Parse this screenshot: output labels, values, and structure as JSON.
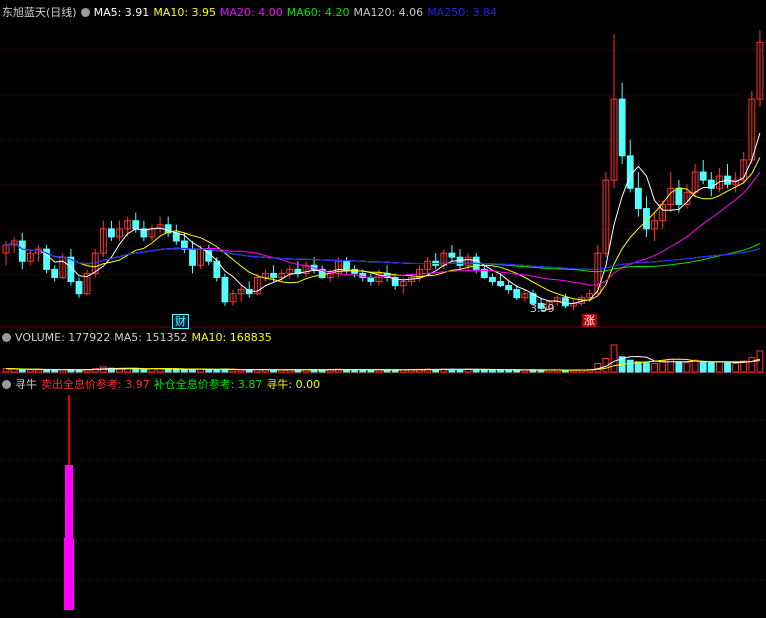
{
  "colors": {
    "bg": "#000000",
    "grid": "#7a0000",
    "up": "#ff3232",
    "down": "#54ffff",
    "ma5": "#ffffff",
    "ma10": "#ffff00",
    "ma20": "#ff00ff",
    "ma60": "#00e600",
    "ma120": "#c8c8c8",
    "ma250": "#2020ff",
    "label_gray": "#d0d0d0"
  },
  "panel_price": {
    "title": "东旭蓝天(日线)",
    "indicators": [
      {
        "label": "MA5: 3.91",
        "color": "#ffffff"
      },
      {
        "label": "MA10: 3.95",
        "color": "#ffff00"
      },
      {
        "label": "MA20: 4.00",
        "color": "#ff00ff"
      },
      {
        "label": "MA60: 4.20",
        "color": "#00e600"
      },
      {
        "label": "MA120: 4.06",
        "color": "#c8c8c8"
      },
      {
        "label": "MA250: 3.84",
        "color": "#2020ff"
      }
    ],
    "low_label": "3.59",
    "marker_cai": "财",
    "marker_zhang": "涨"
  },
  "panel_volume": {
    "indicators": [
      {
        "label": "VOLUME: 177922",
        "color": "#d0d0d0"
      },
      {
        "label": "MA5: 151352",
        "color": "#d0d0d0"
      },
      {
        "label": "MA10: 168835",
        "color": "#ffff00"
      }
    ]
  },
  "panel_indicator": {
    "title": "寻牛",
    "indicators": [
      {
        "label": "卖出全息价参考: 3.97",
        "color": "#ff3232"
      },
      {
        "label": "补仓全息价参考: 3.87",
        "color": "#00e600"
      },
      {
        "label": "寻牛: 0.00",
        "color": "#ffff00"
      }
    ]
  },
  "chart_data": {
    "type": "candlestick",
    "y_range": [
      3.5,
      7.2
    ],
    "candles": [
      [
        4.3,
        4.45,
        4.15,
        4.4
      ],
      [
        4.4,
        4.5,
        4.3,
        4.45
      ],
      [
        4.45,
        4.55,
        4.1,
        4.2
      ],
      [
        4.2,
        4.35,
        4.15,
        4.3
      ],
      [
        4.3,
        4.4,
        4.2,
        4.35
      ],
      [
        4.35,
        4.4,
        4.05,
        4.1
      ],
      [
        4.1,
        4.15,
        3.95,
        4.0
      ],
      [
        4.0,
        4.3,
        3.98,
        4.25
      ],
      [
        4.25,
        4.35,
        3.9,
        3.95
      ],
      [
        3.95,
        4.0,
        3.75,
        3.8
      ],
      [
        3.8,
        4.1,
        3.78,
        4.05
      ],
      [
        4.05,
        4.35,
        4.0,
        4.3
      ],
      [
        4.3,
        4.7,
        4.25,
        4.6
      ],
      [
        4.6,
        4.7,
        4.45,
        4.5
      ],
      [
        4.5,
        4.7,
        4.45,
        4.6
      ],
      [
        4.6,
        4.75,
        4.5,
        4.7
      ],
      [
        4.7,
        4.8,
        4.55,
        4.6
      ],
      [
        4.6,
        4.7,
        4.45,
        4.5
      ],
      [
        4.5,
        4.65,
        4.45,
        4.6
      ],
      [
        4.6,
        4.75,
        4.55,
        4.65
      ],
      [
        4.65,
        4.75,
        4.5,
        4.55
      ],
      [
        4.55,
        4.65,
        4.4,
        4.45
      ],
      [
        4.45,
        4.55,
        4.3,
        4.35
      ],
      [
        4.35,
        4.45,
        4.05,
        4.15
      ],
      [
        4.15,
        4.4,
        4.1,
        4.35
      ],
      [
        4.35,
        4.4,
        4.15,
        4.2
      ],
      [
        4.2,
        4.25,
        3.95,
        4.0
      ],
      [
        4.0,
        4.05,
        3.65,
        3.7
      ],
      [
        3.7,
        3.85,
        3.65,
        3.8
      ],
      [
        3.8,
        3.9,
        3.7,
        3.85
      ],
      [
        3.85,
        3.95,
        3.75,
        3.8
      ],
      [
        3.8,
        4.05,
        3.78,
        4.0
      ],
      [
        4.0,
        4.1,
        3.95,
        4.05
      ],
      [
        4.05,
        4.15,
        3.95,
        4.0
      ],
      [
        4.0,
        4.1,
        3.95,
        4.05
      ],
      [
        4.05,
        4.15,
        3.98,
        4.1
      ],
      [
        4.1,
        4.2,
        4.0,
        4.05
      ],
      [
        4.05,
        4.2,
        4.0,
        4.15
      ],
      [
        4.15,
        4.25,
        4.05,
        4.1
      ],
      [
        4.1,
        4.15,
        3.98,
        4.0
      ],
      [
        4.0,
        4.1,
        3.95,
        4.05
      ],
      [
        4.05,
        4.25,
        4.0,
        4.2
      ],
      [
        4.2,
        4.25,
        4.05,
        4.1
      ],
      [
        4.1,
        4.15,
        4.0,
        4.05
      ],
      [
        4.05,
        4.1,
        3.95,
        4.0
      ],
      [
        4.0,
        4.05,
        3.9,
        3.95
      ],
      [
        3.95,
        4.1,
        3.9,
        4.05
      ],
      [
        4.05,
        4.15,
        3.95,
        4.0
      ],
      [
        4.0,
        4.05,
        3.85,
        3.9
      ],
      [
        3.9,
        4.0,
        3.8,
        3.95
      ],
      [
        3.95,
        4.05,
        3.9,
        4.0
      ],
      [
        4.0,
        4.15,
        3.95,
        4.1
      ],
      [
        4.1,
        4.25,
        4.05,
        4.2
      ],
      [
        4.2,
        4.3,
        4.1,
        4.15
      ],
      [
        4.15,
        4.35,
        4.1,
        4.3
      ],
      [
        4.3,
        4.4,
        4.2,
        4.25
      ],
      [
        4.25,
        4.35,
        4.1,
        4.15
      ],
      [
        4.15,
        4.3,
        4.1,
        4.25
      ],
      [
        4.25,
        4.3,
        4.05,
        4.1
      ],
      [
        4.1,
        4.15,
        3.98,
        4.0
      ],
      [
        4.0,
        4.05,
        3.9,
        3.95
      ],
      [
        3.95,
        4.05,
        3.88,
        3.9
      ],
      [
        3.9,
        3.95,
        3.8,
        3.85
      ],
      [
        3.85,
        3.9,
        3.72,
        3.75
      ],
      [
        3.75,
        3.85,
        3.7,
        3.8
      ],
      [
        3.8,
        3.85,
        3.65,
        3.68
      ],
      [
        3.68,
        3.75,
        3.59,
        3.62
      ],
      [
        3.62,
        3.72,
        3.6,
        3.7
      ],
      [
        3.7,
        3.78,
        3.65,
        3.75
      ],
      [
        3.75,
        3.8,
        3.62,
        3.65
      ],
      [
        3.65,
        3.72,
        3.6,
        3.68
      ],
      [
        3.68,
        3.78,
        3.65,
        3.75
      ],
      [
        3.75,
        3.85,
        3.7,
        3.8
      ],
      [
        3.8,
        4.4,
        3.78,
        4.3
      ],
      [
        4.3,
        5.3,
        4.25,
        5.2
      ],
      [
        5.2,
        7.0,
        5.1,
        6.2
      ],
      [
        6.2,
        6.4,
        5.4,
        5.5
      ],
      [
        5.5,
        5.7,
        5.05,
        5.1
      ],
      [
        5.1,
        5.3,
        4.75,
        4.85
      ],
      [
        4.85,
        5.0,
        4.5,
        4.6
      ],
      [
        4.6,
        4.8,
        4.45,
        4.7
      ],
      [
        4.7,
        4.95,
        4.6,
        4.9
      ],
      [
        4.9,
        5.3,
        4.8,
        5.1
      ],
      [
        5.1,
        5.2,
        4.8,
        4.9
      ],
      [
        4.9,
        5.15,
        4.85,
        5.05
      ],
      [
        5.05,
        5.4,
        5.0,
        5.3
      ],
      [
        5.3,
        5.45,
        5.15,
        5.2
      ],
      [
        5.2,
        5.3,
        5.0,
        5.1
      ],
      [
        5.1,
        5.35,
        5.05,
        5.25
      ],
      [
        5.25,
        5.4,
        5.1,
        5.15
      ],
      [
        5.15,
        5.3,
        5.05,
        5.2
      ],
      [
        5.2,
        5.55,
        5.15,
        5.45
      ],
      [
        5.45,
        6.3,
        5.4,
        6.2
      ],
      [
        6.2,
        7.05,
        6.1,
        6.9
      ]
    ],
    "volume": [
      40,
      35,
      30,
      28,
      26,
      24,
      22,
      30,
      28,
      26,
      30,
      40,
      60,
      45,
      40,
      42,
      38,
      35,
      36,
      40,
      34,
      30,
      28,
      32,
      36,
      30,
      28,
      34,
      26,
      24,
      24,
      30,
      28,
      26,
      26,
      28,
      26,
      30,
      28,
      26,
      26,
      34,
      30,
      28,
      26,
      24,
      28,
      26,
      24,
      26,
      28,
      32,
      36,
      30,
      34,
      32,
      30,
      32,
      30,
      28,
      26,
      24,
      24,
      22,
      24,
      26,
      22,
      24,
      24,
      22,
      20,
      24,
      28,
      100,
      160,
      320,
      180,
      140,
      120,
      110,
      100,
      130,
      150,
      120,
      110,
      140,
      120,
      110,
      120,
      110,
      100,
      130,
      170,
      250
    ]
  }
}
